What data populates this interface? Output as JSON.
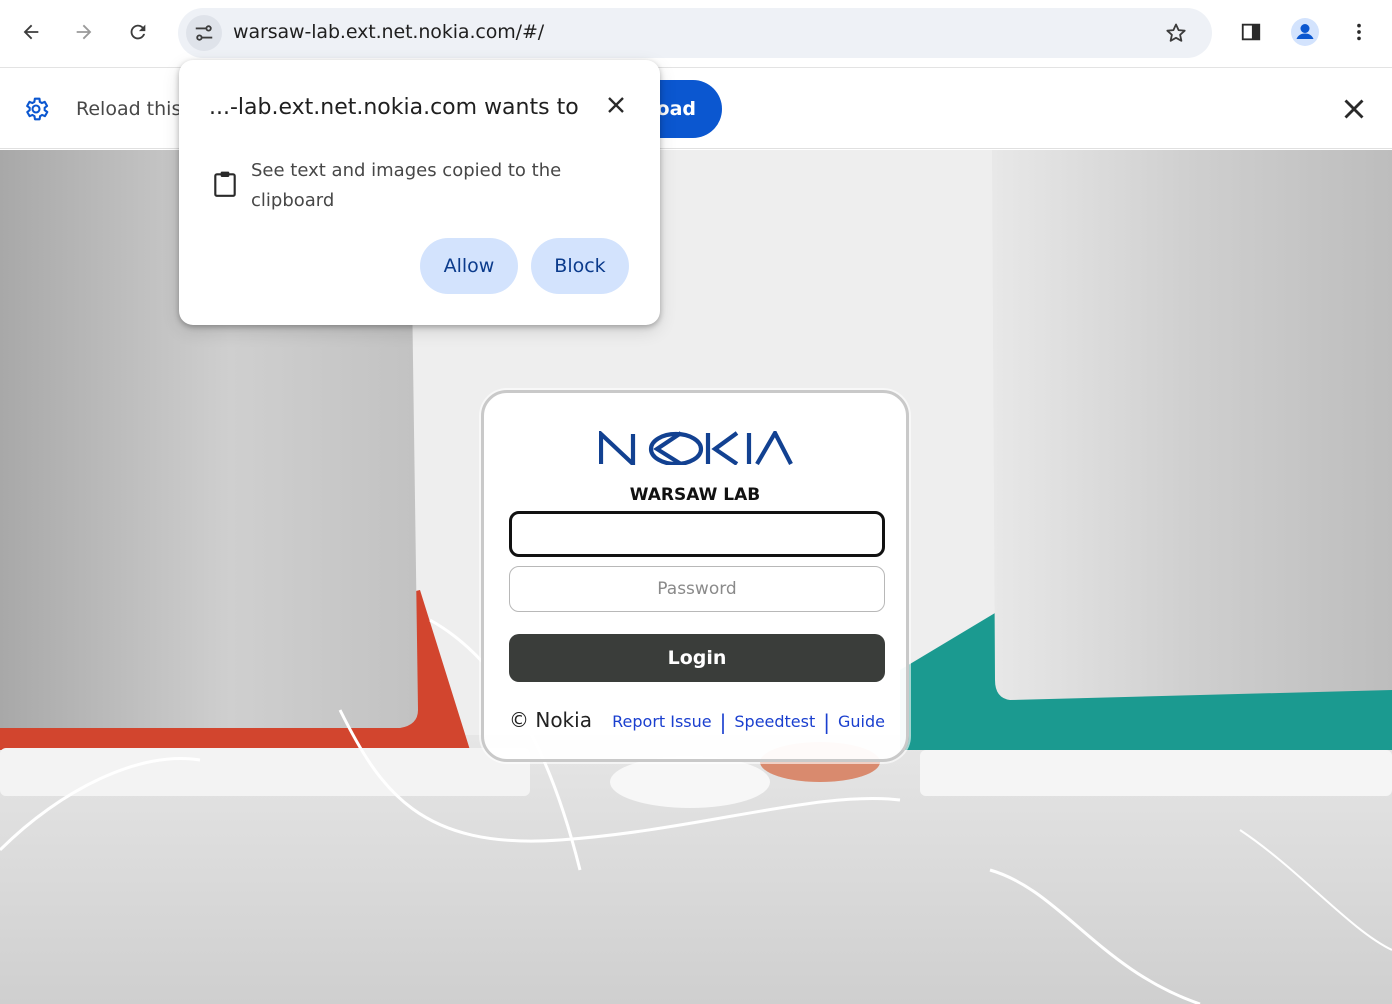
{
  "browser": {
    "url": "warsaw-lab.ext.net.nokia.com/#/",
    "icons": {
      "back": "arrow-left-icon",
      "forward": "arrow-right-icon",
      "reload": "reload-icon",
      "site_info": "tune-icon",
      "bookmark": "star-icon",
      "side_panel": "side-panel-icon",
      "profile": "person-icon",
      "menu": "kebab-menu-icon"
    }
  },
  "infobar": {
    "text": "Reload this",
    "button_label": "load",
    "icons": {
      "settings": "gear-icon",
      "close": "close-icon"
    }
  },
  "permission_prompt": {
    "title": "...-lab.ext.net.nokia.com wants to",
    "description": "See text and images copied to the clipboard",
    "allow_label": "Allow",
    "block_label": "Block",
    "icons": {
      "clipboard": "clipboard-icon",
      "close": "close-icon"
    }
  },
  "login": {
    "logo_text": "NOKIA",
    "lab_name": "WARSAW LAB",
    "username_value": "",
    "password_placeholder": "Password",
    "login_label": "Login",
    "copyright": "© Nokia",
    "links": [
      "Report Issue",
      "Speedtest",
      "Guide"
    ]
  },
  "colors": {
    "brand_blue": "#124191",
    "chrome_blue": "#0b57d0",
    "button_tonal": "#d3e3fd",
    "login_button": "#3a3d3a",
    "link": "#1a3fcf"
  }
}
